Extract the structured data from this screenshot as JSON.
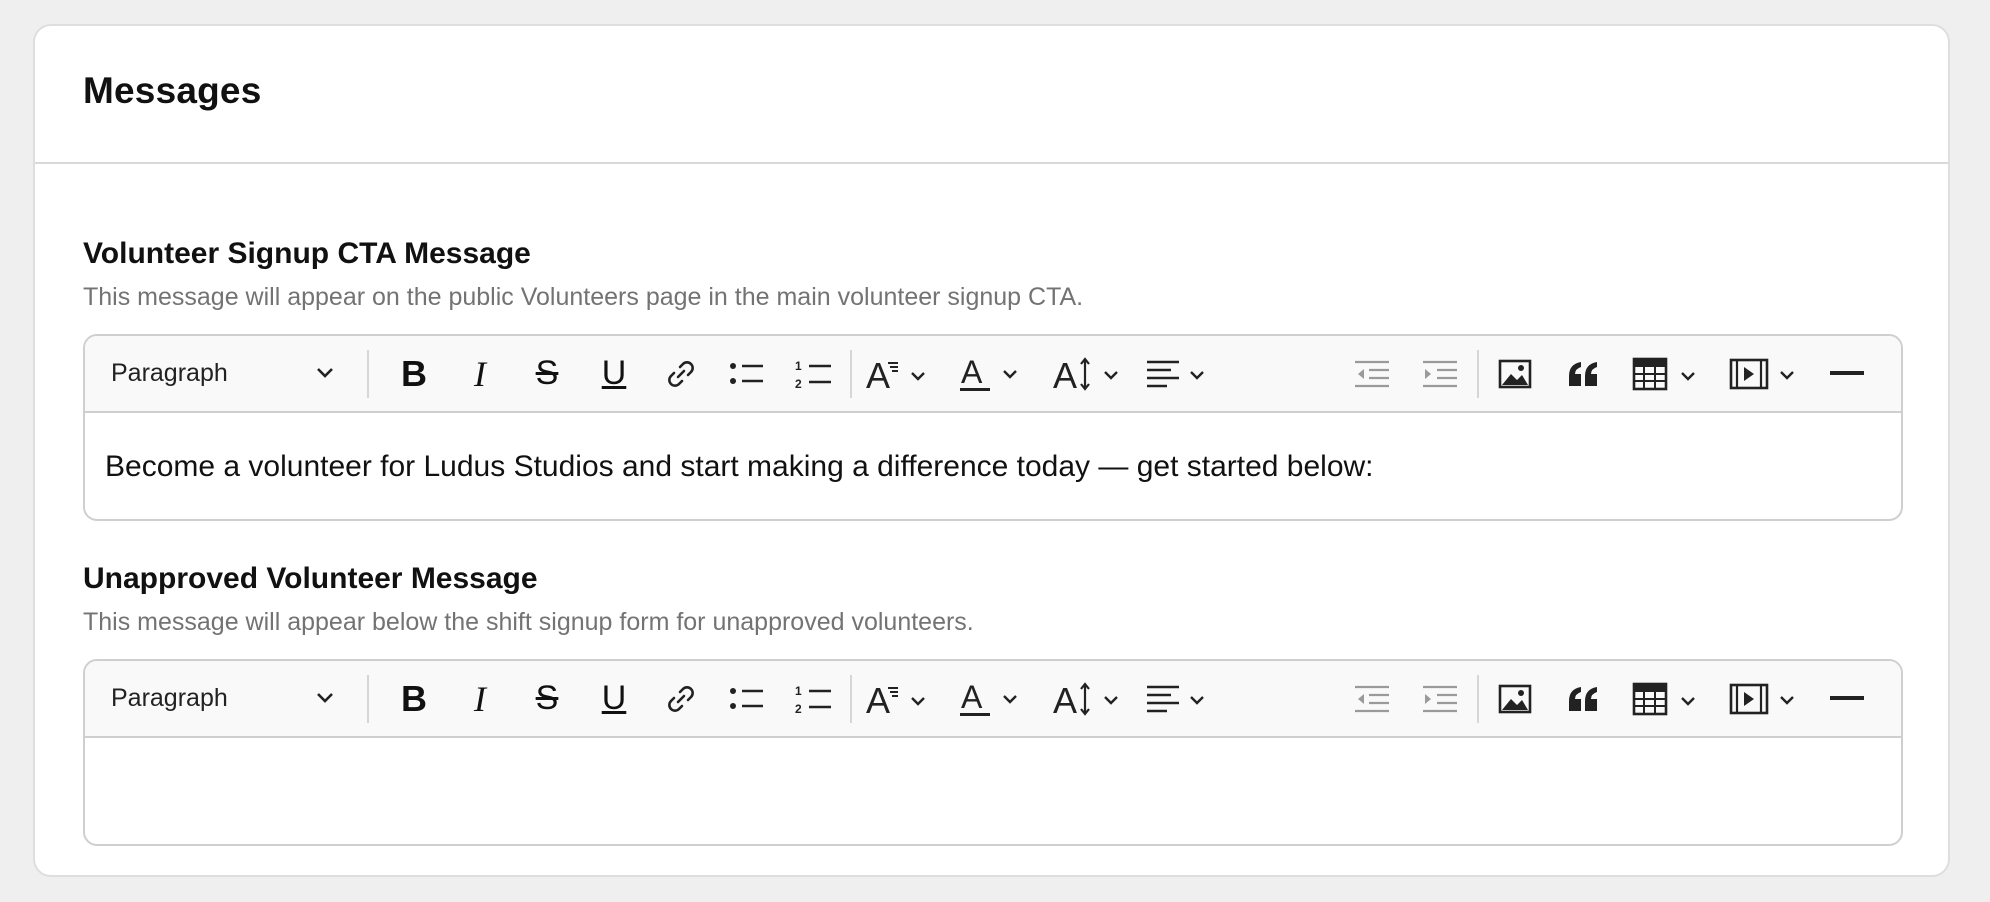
{
  "card": {
    "title": "Messages"
  },
  "fields": [
    {
      "title": "Volunteer Signup CTA Message",
      "description": "This message will appear on the public Volunteers page in the main volunteer signup CTA.",
      "block_format": "Paragraph",
      "content": "Become a volunteer for Ludus Studios and start making a difference today — get started below:"
    },
    {
      "title": "Unapproved Volunteer Message",
      "description": "This message will appear below the shift signup form for unapproved volunteers.",
      "block_format": "Paragraph",
      "content": ""
    }
  ],
  "toolbar_icons": [
    "bold-icon",
    "italic-icon",
    "strikethrough-icon",
    "underline-icon",
    "link-icon",
    "bullet-list-icon",
    "numbered-list-icon",
    "font-size-icon",
    "text-color-icon",
    "line-height-icon",
    "align-left-icon",
    "outdent-icon",
    "indent-icon",
    "image-icon",
    "blockquote-icon",
    "table-icon",
    "media-icon",
    "horizontal-rule-icon",
    "more-icon"
  ],
  "colors": {
    "background": "#efefef",
    "card": "#ffffff",
    "muted_text": "#737373",
    "disabled_icon": "#9a9a9a",
    "icon": "#222222"
  }
}
